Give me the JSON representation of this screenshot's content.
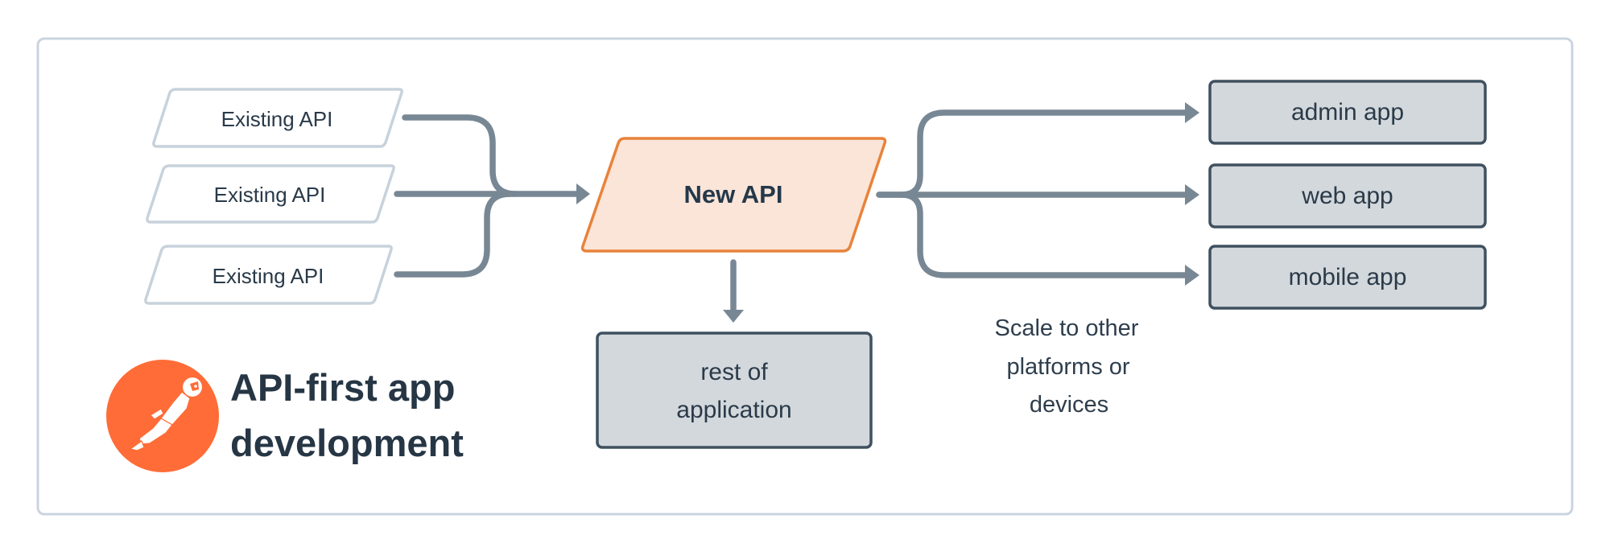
{
  "diagram": {
    "title_lines": [
      "API-first app",
      "development"
    ],
    "sources": [
      {
        "label": "Existing API"
      },
      {
        "label": "Existing API"
      },
      {
        "label": "Existing API"
      }
    ],
    "hub": {
      "label": "New API"
    },
    "downstream": {
      "lines": [
        "rest of",
        "application"
      ]
    },
    "targets": [
      {
        "label": "admin app"
      },
      {
        "label": "web app"
      },
      {
        "label": "mobile app"
      }
    ],
    "note_lines": [
      "Scale to other",
      "platforms or",
      "devices"
    ],
    "logo": {
      "name": "postman-logo",
      "color": "#ff6c37"
    },
    "colors": {
      "hub_fill": "#fae5d8",
      "hub_border": "#e8833a",
      "box_fill": "#d3d8dc",
      "box_border": "#3f505f",
      "connector": "#788794",
      "source_border": "#c7d2dc",
      "frame_border": "#c9d4df",
      "text": "#263645"
    }
  }
}
